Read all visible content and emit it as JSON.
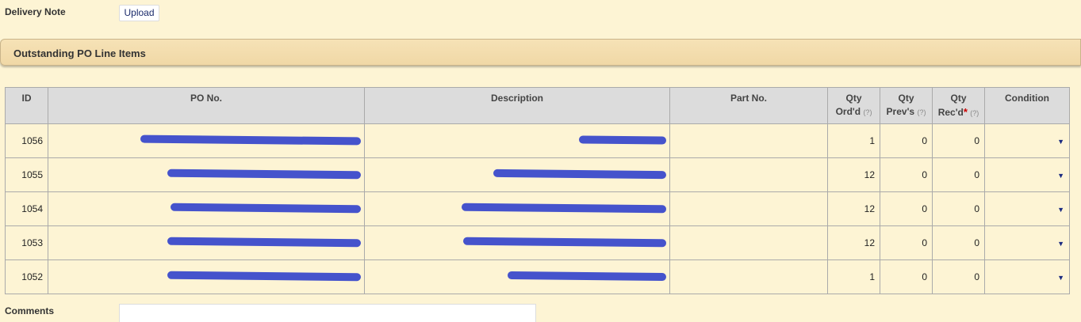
{
  "delivery_note": {
    "label": "Delivery Note",
    "upload_label": "Upload"
  },
  "section": {
    "title": "Outstanding PO Line Items"
  },
  "table": {
    "headers": {
      "id": "ID",
      "po_no": "PO No.",
      "description": "Description",
      "part_no": "Part No.",
      "qty_ordd": {
        "line1": "Qty",
        "line2": "Ord'd",
        "hint": "(?)"
      },
      "qty_prevs": {
        "line1": "Qty",
        "line2": "Prev's",
        "hint": "(?)"
      },
      "qty_recd": {
        "line1": "Qty",
        "line2": "Rec'd",
        "required": "*",
        "hint": "(?)"
      },
      "condition": "Condition"
    },
    "rows": [
      {
        "id": "1056",
        "ordd": "1",
        "prevs": "0",
        "recd": "0"
      },
      {
        "id": "1055",
        "ordd": "12",
        "prevs": "0",
        "recd": "0"
      },
      {
        "id": "1054",
        "ordd": "12",
        "prevs": "0",
        "recd": "0"
      },
      {
        "id": "1053",
        "ordd": "12",
        "prevs": "0",
        "recd": "0"
      },
      {
        "id": "1052",
        "ordd": "1",
        "prevs": "0",
        "recd": "0"
      }
    ]
  },
  "comments": {
    "label": "Comments"
  }
}
